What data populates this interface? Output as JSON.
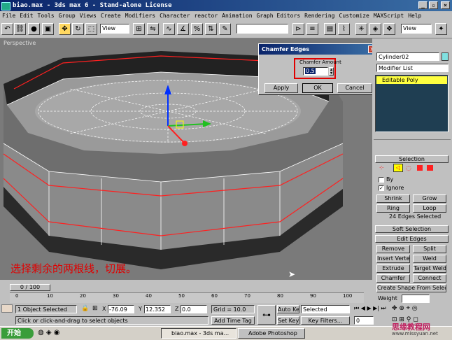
{
  "window": {
    "title": "biao.max - 3ds max 6 - Stand-alone License"
  },
  "menu": [
    "File",
    "Edit",
    "Tools",
    "Group",
    "Views",
    "Create",
    "Modifiers",
    "Character",
    "reactor",
    "Animation",
    "Graph Editors",
    "Rendering",
    "Customize",
    "MAXScript",
    "Help"
  ],
  "toolbar": {
    "view_dropdown": "View",
    "view_dropdown_right": "View"
  },
  "viewport": {
    "label": "Perspective",
    "annotation": "选择剩余的两根线，切展。"
  },
  "dialog": {
    "title": "Chamfer Edges",
    "field_label": "Chamfer Amount",
    "value": "0.5",
    "apply": "Apply",
    "ok": "OK",
    "cancel": "Cancel"
  },
  "panel": {
    "object_name": "Cylinder02",
    "modifier_list": "Modifier List",
    "stack_item": "Editable Poly",
    "selection": {
      "header": "Selection",
      "by": "By",
      "ignore": "Ignore",
      "shrink": "Shrink",
      "grow": "Grow",
      "ring": "Ring",
      "loop": "Loop",
      "count": "24 Edges Selected"
    },
    "soft_selection": "Soft Selection",
    "edit_edges": {
      "header": "Edit Edges",
      "remove": "Remove",
      "split": "Split",
      "insert_vertex": "Insert Vertex",
      "weld": "Weld",
      "extrude": "Extrude",
      "target_weld": "Target Weld",
      "chamfer": "Chamfer",
      "connect": "Connect",
      "create_shape": "Create Shape From Selection",
      "weight": "Weight"
    }
  },
  "timeline": {
    "frame": "0 / 100",
    "ticks": [
      "0",
      "10",
      "20",
      "30",
      "40",
      "50",
      "60",
      "70",
      "80",
      "90",
      "100"
    ]
  },
  "status": {
    "selected": "1 Object Selected",
    "prompt": "Click or click-and-drag to select objects",
    "x_label": "X",
    "x_value": "-76.09",
    "y_label": "Y",
    "y_value": "12.352",
    "z_label": "Z",
    "z_value": "0.0",
    "grid": "Grid = 10.0",
    "add_time_tag": "Add Time Tag",
    "auto_key": "Auto Key",
    "set_key": "Set Key",
    "selected_dropdown": "Selected",
    "key_filters": "Key Filters...",
    "frame_value": "0"
  },
  "taskbar": {
    "start": "开始",
    "task1": "biao.max - 3ds ma...",
    "task2": "Adobe Photoshop",
    "watermark": "思缘教程网",
    "watermark_url": "www.missyuan.net"
  },
  "colors": {
    "selected_edge": "#ff2020",
    "accent_yellow": "#ffff00",
    "annotation": "#e00000"
  }
}
